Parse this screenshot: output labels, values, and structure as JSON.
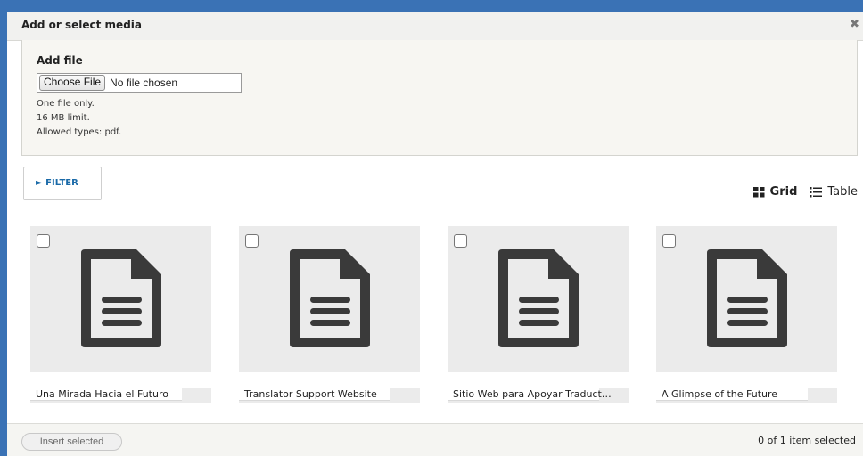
{
  "dialog": {
    "title": "Add or select media",
    "close_glyph": "✖"
  },
  "upload": {
    "label": "Add file",
    "choose_button": "Choose File",
    "file_status": "No file chosen",
    "help_lines": [
      "One file only.",
      "16 MB limit.",
      "Allowed types: pdf."
    ]
  },
  "filter": {
    "label": "► FILTER"
  },
  "view_switch": {
    "grid_label": "Grid",
    "table_label": "Table",
    "grid_icon": "grid-icon",
    "table_icon": "list-icon"
  },
  "media_items": [
    {
      "name": "Una Mirada Hacia el Futuro",
      "icon": "document-icon",
      "checked": false
    },
    {
      "name": "Translator Support Website",
      "icon": "document-icon",
      "checked": false
    },
    {
      "name": "Sitio Web para Apoyar Traduct…",
      "icon": "document-icon",
      "checked": false
    },
    {
      "name": "A Glimpse of the Future",
      "icon": "document-icon",
      "checked": false
    }
  ],
  "footer": {
    "insert_button": "Insert selected",
    "selection_count": "0 of 1 item selected"
  },
  "colors": {
    "page_background": "#3a72b5",
    "accent_link": "#1a6aa8",
    "card_background": "#ebebeb",
    "icon_color": "#3a3a3a"
  }
}
